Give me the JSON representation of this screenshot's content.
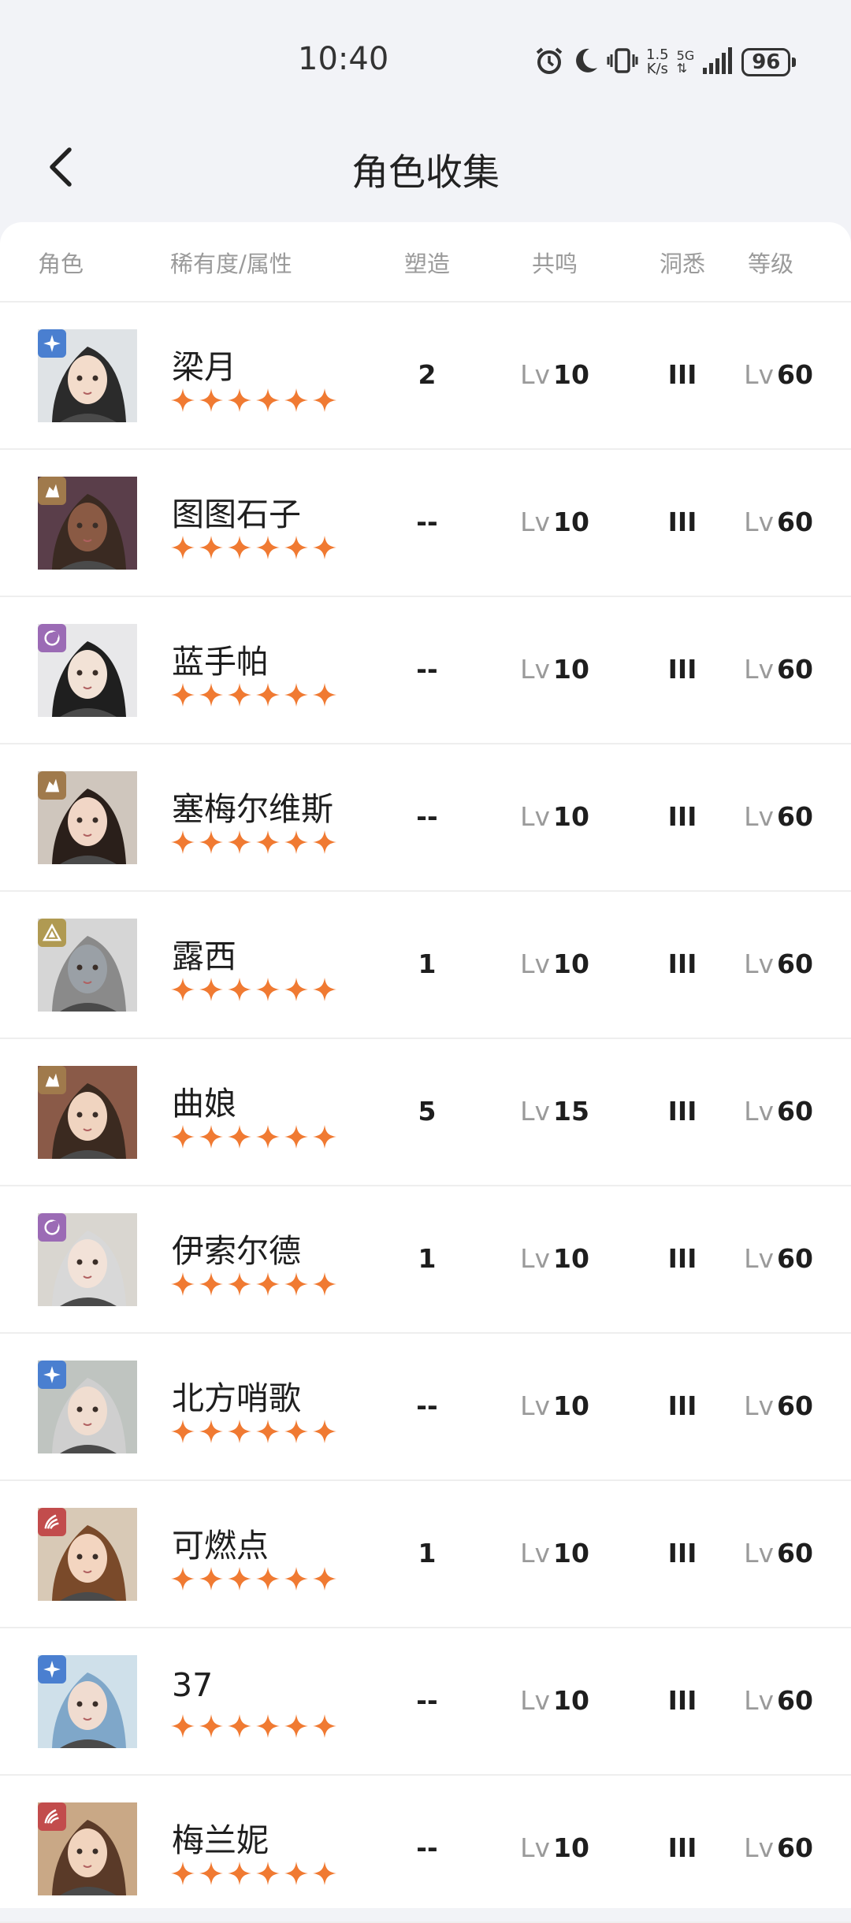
{
  "status": {
    "time": "10:40",
    "speed_top": "1.5",
    "speed_bottom": "K/s",
    "network": "5G",
    "battery": "96"
  },
  "header": {
    "title": "角色收集",
    "back_icon": "chevron-left-icon"
  },
  "columns": {
    "role": "角色",
    "rarity_attr": "稀有度/属性",
    "forge": "塑造",
    "resonance": "共鸣",
    "insight": "洞悉",
    "level": "等级"
  },
  "lv_prefix": "Lv",
  "colors": {
    "star": "#f07a32",
    "blue": "#4a7fd0",
    "brown": "#a07a4c",
    "purple": "#9b6bb5",
    "olive": "#b09a52",
    "red": "#c24c4c"
  },
  "characters": [
    {
      "name": "梁月",
      "stars": 6,
      "attribute": "blue",
      "attribute_icon": "star-sparkle-icon",
      "forge": "2",
      "resonance": "10",
      "insight": "III",
      "level": "60"
    },
    {
      "name": "图图石子",
      "stars": 6,
      "attribute": "brown",
      "attribute_icon": "mineral-icon",
      "forge": "--",
      "resonance": "10",
      "insight": "III",
      "level": "60"
    },
    {
      "name": "蓝手帕",
      "stars": 6,
      "attribute": "purple",
      "attribute_icon": "crescent-icon",
      "forge": "--",
      "resonance": "10",
      "insight": "III",
      "level": "60"
    },
    {
      "name": "塞梅尔维斯",
      "stars": 6,
      "attribute": "brown",
      "attribute_icon": "mineral-icon",
      "forge": "--",
      "resonance": "10",
      "insight": "III",
      "level": "60"
    },
    {
      "name": "露西",
      "stars": 6,
      "attribute": "olive",
      "attribute_icon": "pyramid-icon",
      "forge": "1",
      "resonance": "10",
      "insight": "III",
      "level": "60"
    },
    {
      "name": "曲娘",
      "stars": 6,
      "attribute": "brown",
      "attribute_icon": "mineral-icon",
      "forge": "5",
      "resonance": "15",
      "insight": "III",
      "level": "60"
    },
    {
      "name": "伊索尔德",
      "stars": 6,
      "attribute": "purple",
      "attribute_icon": "crescent-icon",
      "forge": "1",
      "resonance": "10",
      "insight": "III",
      "level": "60"
    },
    {
      "name": "北方哨歌",
      "stars": 6,
      "attribute": "blue",
      "attribute_icon": "star-sparkle-icon",
      "forge": "--",
      "resonance": "10",
      "insight": "III",
      "level": "60"
    },
    {
      "name": "可燃点",
      "stars": 6,
      "attribute": "red",
      "attribute_icon": "flame-icon",
      "forge": "1",
      "resonance": "10",
      "insight": "III",
      "level": "60"
    },
    {
      "name": "37",
      "stars": 6,
      "attribute": "blue",
      "attribute_icon": "star-sparkle-icon",
      "forge": "--",
      "resonance": "10",
      "insight": "III",
      "level": "60"
    },
    {
      "name": "梅兰妮",
      "stars": 6,
      "attribute": "red",
      "attribute_icon": "flame-icon",
      "forge": "--",
      "resonance": "10",
      "insight": "III",
      "level": "60"
    }
  ]
}
